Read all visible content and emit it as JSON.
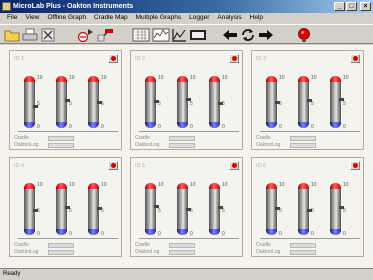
{
  "window": {
    "title": "MicroLab Plus - Oakton Instruments",
    "minimize_icon": "minimize-icon",
    "maximize_icon": "maximize-icon",
    "close_icon": "close-icon"
  },
  "menu": [
    "File",
    "View",
    "Offline Graph",
    "Cradle Map",
    "Multiple Graphs",
    "Logger",
    "Analysis",
    "Help"
  ],
  "toolbar": {
    "icons": [
      "folder-icon",
      "print-icon",
      "delete-icon",
      "upload-icon",
      "download-icon",
      "bar-chart-icon",
      "multi-graph-icon",
      "graph-icon",
      "digital-display-icon",
      "back-arrow-icon",
      "refresh-icon",
      "forward-arrow-icon",
      "record-icon"
    ]
  },
  "panels": [
    {
      "id": "ID 1",
      "cradle": "Cradle",
      "oakton": "OaktonLog"
    },
    {
      "id": "ID 2",
      "cradle": "Cradle",
      "oakton": "OaktonLog"
    },
    {
      "id": "ID 3",
      "cradle": "Cradle",
      "oakton": "OaktonLog"
    },
    {
      "id": "ID 4",
      "cradle": "Cradle",
      "oakton": "OaktonLog"
    },
    {
      "id": "ID 5",
      "cradle": "Cradle",
      "oakton": "OaktonLog"
    },
    {
      "id": "ID 6",
      "cradle": "Cradle",
      "oakton": "OaktonLog"
    }
  ],
  "gauge_ticks": {
    "top": "10",
    "mid": "5",
    "bottom": "0"
  },
  "status": "Ready",
  "colors": {
    "titlebar": "#0a246a",
    "record": "#cc0000",
    "gauge_top": "#ff4040",
    "gauge_bottom": "#4040ff"
  }
}
